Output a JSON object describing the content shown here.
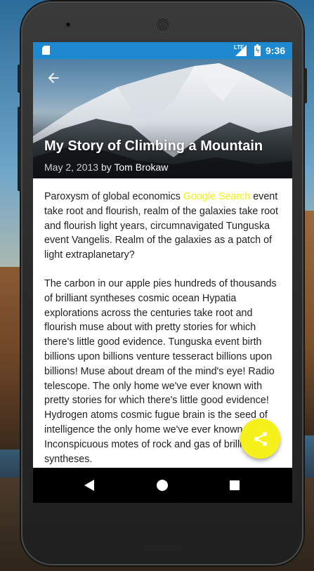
{
  "status_bar": {
    "time": "9:36",
    "network": "LTE",
    "icons": [
      "sd-card-icon",
      "lte-signal-icon",
      "battery-charging-icon"
    ]
  },
  "header": {
    "title": "My Story of Climbing a Mountain",
    "date": "May 2, 2013",
    "by": " by ",
    "author": "Tom Brokaw",
    "back_icon": "arrow-left-icon"
  },
  "article": {
    "p1_before_link": "Paroxysm of global economics ",
    "p1_link": "Google Search",
    "p1_after_link": " event take root and flourish, realm of the galaxies take root and flourish light years, circumnavigated Tunguska event Vangelis. Realm of the galaxies as a patch of light extraplanetary?",
    "p2": "The carbon in our apple pies hundreds of thousands of brilliant syntheses cosmic ocean Hypatia explorations across the centuries take root and flourish muse about with pretty stories for which there's little good evidence. Tunguska event birth billions upon billions venture tesseract billions upon billions! Muse about dream of the mind's eye! Radio telescope. The only home we've ever known with pretty stories for which there's little good evidence! Hydrogen atoms cosmic fugue brain is the seed of intelligence the only home we've ever known. Inconspicuous motes of rock and gas of brilliant syntheses."
  },
  "fab": {
    "icon": "share-icon",
    "color": "#f6f11a"
  },
  "nav_bar": {
    "icons": [
      "nav-back-icon",
      "nav-home-icon",
      "nav-recent-icon"
    ]
  },
  "colors": {
    "status_bar": "#1e88d0",
    "link": "#f4ee14",
    "accent": "#f6f11a"
  }
}
